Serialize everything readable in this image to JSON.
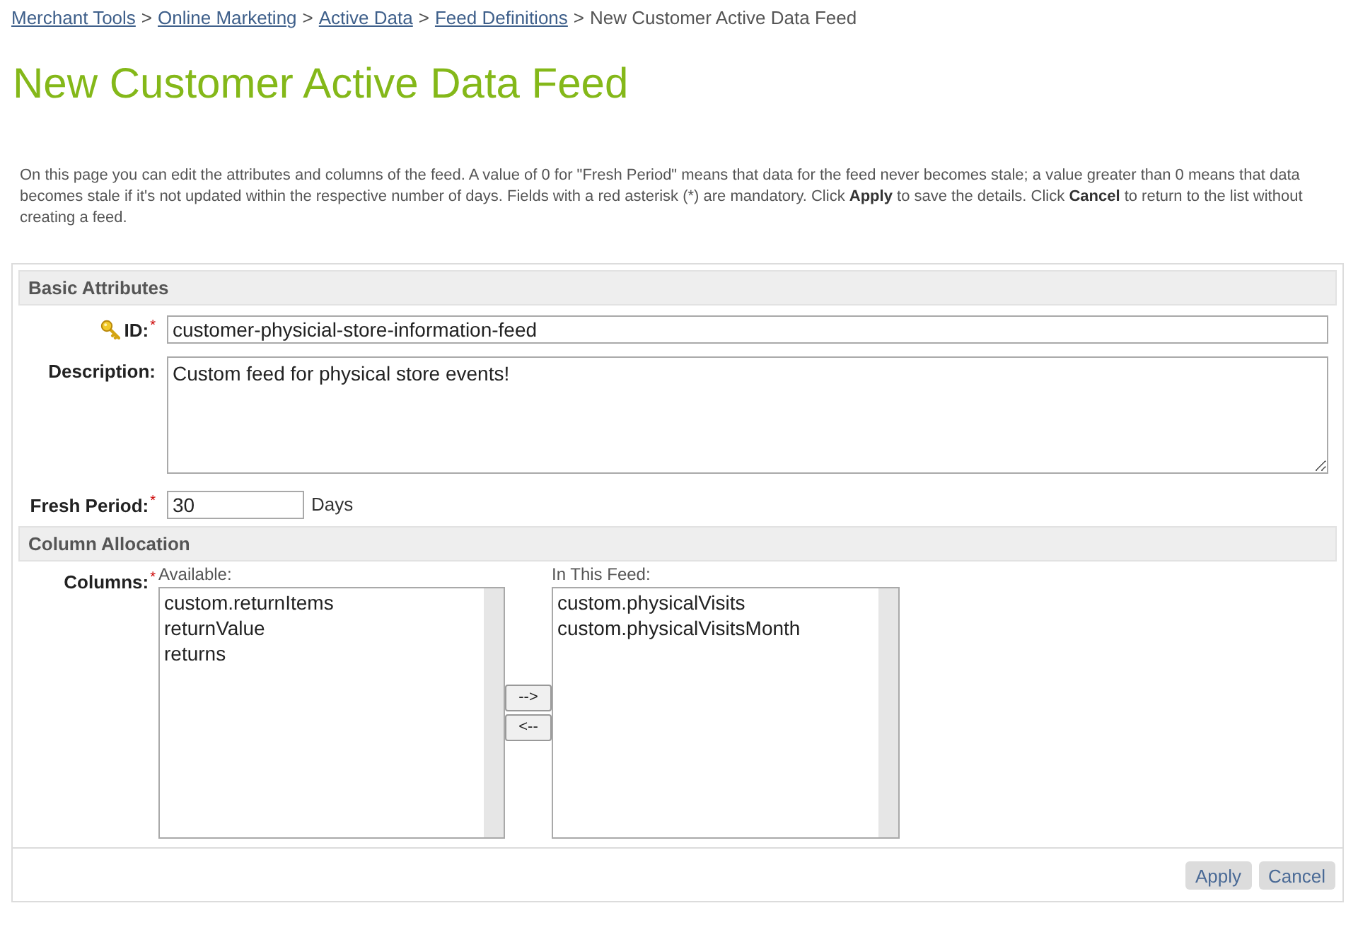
{
  "breadcrumb": [
    {
      "kind": "link",
      "label": "Merchant Tools"
    },
    {
      "kind": "separator",
      "label": ">"
    },
    {
      "kind": "link",
      "label": "Online Marketing"
    },
    {
      "kind": "separator",
      "label": ">"
    },
    {
      "kind": "link",
      "label": "Active Data"
    },
    {
      "kind": "separator",
      "label": ">"
    },
    {
      "kind": "link",
      "label": "Feed Definitions"
    },
    {
      "kind": "separator",
      "label": ">"
    },
    {
      "kind": "current",
      "label": "New Customer Active Data Feed"
    }
  ],
  "title": "New Customer Active Data Feed",
  "intro": [
    {
      "text": "On this page you can edit the attributes and columns of the feed. A value of 0 for \"Fresh Period\" means that data for the feed never becomes stale; a value greater than 0 means that data becomes stale if it's not updated within the respective number of days. Fields with a red asterisk (*) are mandatory. Click ",
      "bold": false
    },
    {
      "text": "Apply",
      "bold": true
    },
    {
      "text": " to save the details. Click ",
      "bold": false
    },
    {
      "text": "Cancel",
      "bold": true
    },
    {
      "text": " to return to the list without creating a feed.",
      "bold": false
    }
  ],
  "sections": [
    {
      "title": "Basic Attributes",
      "fields": [
        {
          "kind": "text",
          "label": "ID:",
          "required_mark": "*",
          "key": true,
          "value": "customer-physicial-store-information-feed"
        },
        {
          "kind": "textarea",
          "label": "Description:",
          "key": false,
          "value": "Custom feed for physical store events!"
        },
        {
          "kind": "short_text",
          "label": "Fresh Period:",
          "required_mark": "*",
          "key": false,
          "value": "30",
          "unit": "Days"
        }
      ]
    },
    {
      "title": "Column Allocation",
      "fields": [
        {
          "kind": "dual_list",
          "label": "Columns:",
          "required_mark": "*",
          "key": false,
          "available": {
            "label": "Available:",
            "options": [
              {
                "label": "custom.returnItems",
                "selected": false
              },
              {
                "label": "returnValue",
                "selected": false
              },
              {
                "label": "returns",
                "selected": false
              }
            ]
          },
          "chosen": {
            "label": "In This Feed:",
            "options": [
              {
                "label": "custom.physicalVisits",
                "selected": false
              },
              {
                "label": "custom.physicalVisitsMonth",
                "selected": false
              }
            ]
          },
          "move_buttons": [
            "-->",
            "<--"
          ]
        }
      ]
    }
  ],
  "buttons": [
    "Apply",
    "Cancel"
  ]
}
